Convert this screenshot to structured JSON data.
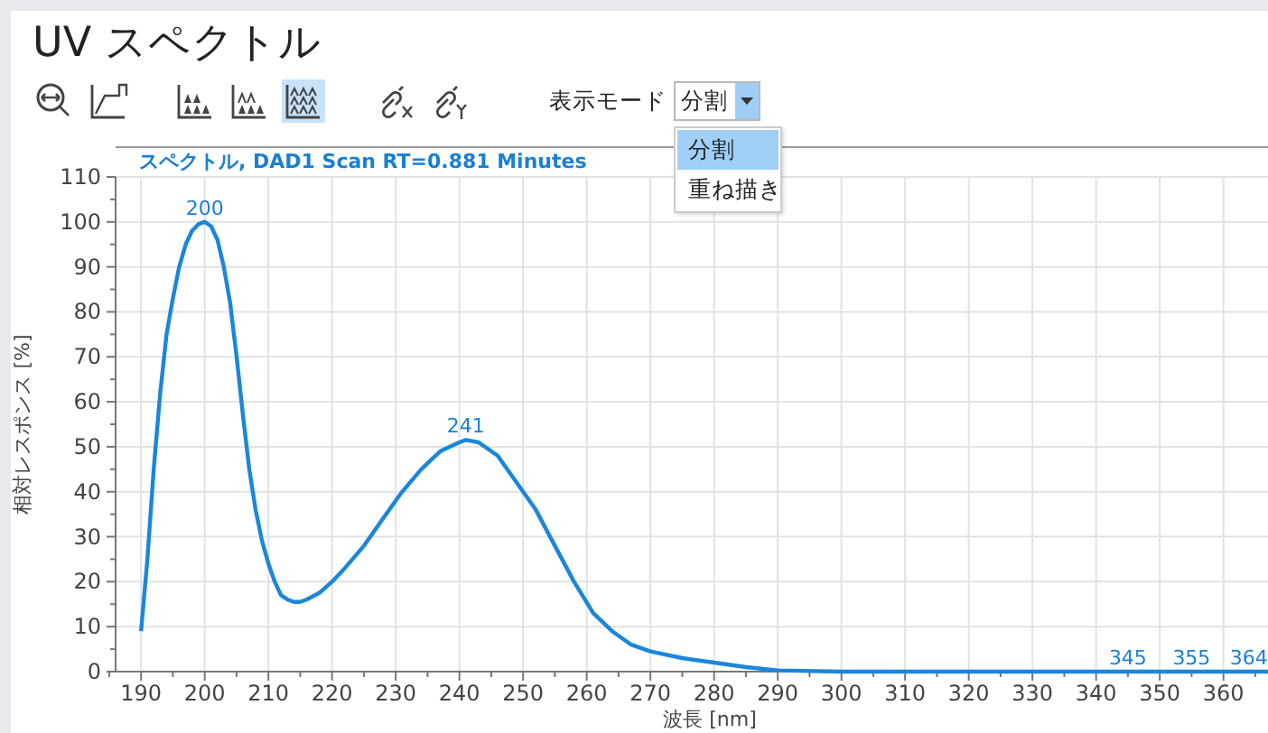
{
  "title": "UV スペクトル",
  "toolbar": [
    {
      "kind": "zoom-out",
      "selected": false
    },
    {
      "kind": "baseline",
      "selected": false
    },
    {
      "kind": "peaks-solid",
      "selected": false
    },
    {
      "kind": "peaks-mixed",
      "selected": false
    },
    {
      "kind": "peaks-outline",
      "selected": true
    },
    {
      "kind": "unlink-x",
      "selected": false
    },
    {
      "kind": "unlink-y",
      "selected": false
    }
  ],
  "display_mode": {
    "label": "表示モード",
    "value": "分割",
    "expanded": true,
    "options": [
      {
        "label": "分割",
        "selected": true
      },
      {
        "label": "重ね描き",
        "selected": false
      }
    ]
  },
  "chart": {
    "header": "スペクトル, DAD1 Scan RT=0.881 Minutes",
    "chart_data": {
      "type": "line",
      "xlabel": "波長 [nm]",
      "ylabel": "相対レスポンス [%]",
      "x": [
        190,
        191,
        192,
        193,
        194,
        195,
        196,
        197,
        198,
        199,
        200,
        201,
        202,
        203,
        204,
        205,
        206,
        207,
        208,
        209,
        210,
        211,
        212,
        213,
        214,
        215,
        216,
        218,
        220,
        222,
        225,
        228,
        231,
        234,
        237,
        240,
        241,
        243,
        246,
        249,
        252,
        255,
        258,
        261,
        264,
        267,
        270,
        275,
        280,
        285,
        290,
        300,
        320,
        340,
        367
      ],
      "series": [
        {
          "color": "#1a86dc",
          "values": [
            9,
            25,
            45,
            62,
            75,
            83,
            90,
            95,
            98,
            99.5,
            100,
            99,
            96,
            90,
            82,
            70,
            57,
            45,
            36,
            29,
            24,
            20,
            17,
            16,
            15.5,
            15.5,
            16,
            17.5,
            20,
            23,
            28,
            34,
            40,
            45,
            49,
            51,
            51.5,
            51,
            48,
            42,
            36,
            28,
            20,
            13,
            9,
            6,
            4.5,
            3,
            2,
            1,
            0.3,
            0,
            0,
            0,
            0
          ]
        }
      ],
      "grid": true,
      "xlim": [
        186,
        367
      ],
      "ylim": [
        0,
        110
      ],
      "xticks": [
        190,
        200,
        210,
        220,
        230,
        240,
        250,
        260,
        270,
        280,
        290,
        300,
        310,
        320,
        330,
        340,
        350,
        360
      ],
      "yticks": [
        0,
        10,
        20,
        30,
        40,
        50,
        60,
        70,
        80,
        90,
        100,
        110
      ],
      "annotations": [
        {
          "x": 200,
          "y": 100,
          "text": "200"
        },
        {
          "x": 241,
          "y": 51.5,
          "text": "241"
        },
        {
          "x": 345,
          "y": 0,
          "text": "345"
        },
        {
          "x": 355,
          "y": 0,
          "text": "355"
        },
        {
          "x": 364,
          "y": 0,
          "text": "364"
        }
      ]
    }
  }
}
